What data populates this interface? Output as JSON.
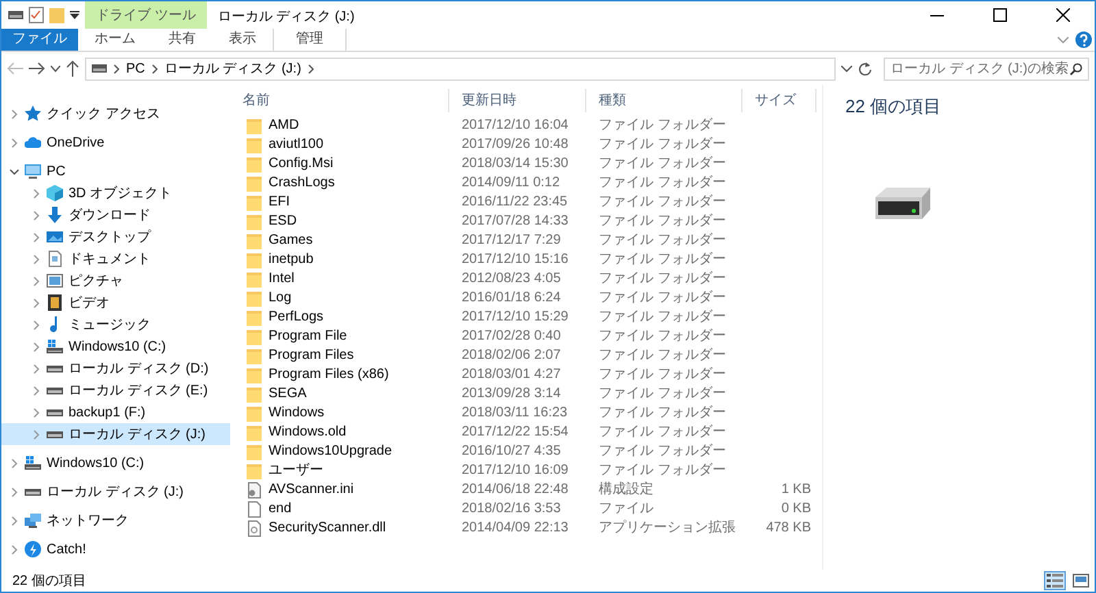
{
  "window": {
    "title": "ローカル ディスク (J:)",
    "context_tab_group": "ドライブ ツール"
  },
  "ribbon_tabs": [
    {
      "label": "ファイル",
      "kind": "file",
      "selected": false
    },
    {
      "label": "ホーム",
      "kind": "tab",
      "selected": false
    },
    {
      "label": "共有",
      "kind": "tab",
      "selected": false
    },
    {
      "label": "表示",
      "kind": "tab",
      "selected": false
    },
    {
      "label": "管理",
      "kind": "context",
      "selected": false
    }
  ],
  "address": {
    "breadcrumbs": [
      "PC",
      "ローカル ディスク (J:)"
    ],
    "search_placeholder": "ローカル ディスク (J:)の検索"
  },
  "navigation": [
    {
      "label": "クイック アクセス",
      "kind": "star",
      "expanded": false,
      "selected": false
    },
    {
      "label": "OneDrive",
      "kind": "cloud",
      "expanded": false,
      "selected": false
    },
    {
      "label": "PC",
      "kind": "pc",
      "expanded": true,
      "selected": false,
      "children": [
        {
          "label": "3D オブジェクト",
          "kind": "cube",
          "expanded": false,
          "selected": false
        },
        {
          "label": "ダウンロード",
          "kind": "download",
          "expanded": false,
          "selected": false
        },
        {
          "label": "デスクトップ",
          "kind": "desktop",
          "expanded": false,
          "selected": false
        },
        {
          "label": "ドキュメント",
          "kind": "document",
          "expanded": false,
          "selected": false
        },
        {
          "label": "ピクチャ",
          "kind": "picture",
          "expanded": false,
          "selected": false
        },
        {
          "label": "ビデオ",
          "kind": "video",
          "expanded": false,
          "selected": false
        },
        {
          "label": "ミュージック",
          "kind": "music",
          "expanded": false,
          "selected": false
        },
        {
          "label": "Windows10 (C:)",
          "kind": "windrive",
          "expanded": false,
          "selected": false
        },
        {
          "label": "ローカル ディスク (D:)",
          "kind": "drive",
          "expanded": false,
          "selected": false
        },
        {
          "label": "ローカル ディスク (E:)",
          "kind": "drive",
          "expanded": false,
          "selected": false
        },
        {
          "label": "backup1 (F:)",
          "kind": "drive",
          "expanded": false,
          "selected": false
        },
        {
          "label": "ローカル ディスク (J:)",
          "kind": "drive",
          "expanded": false,
          "selected": true
        }
      ]
    },
    {
      "label": "Windows10 (C:)",
      "kind": "windrive",
      "expanded": false,
      "selected": false
    },
    {
      "label": "ローカル ディスク (J:)",
      "kind": "drive",
      "expanded": false,
      "selected": false
    },
    {
      "label": "ネットワーク",
      "kind": "network",
      "expanded": false,
      "selected": false
    },
    {
      "label": "Catch!",
      "kind": "catch",
      "expanded": false,
      "selected": false
    }
  ],
  "columns": [
    "名前",
    "更新日時",
    "種類",
    "サイズ"
  ],
  "files": [
    {
      "name": "AMD",
      "modified": "2017/12/10 16:04",
      "type": "ファイル フォルダー",
      "kind": "folder"
    },
    {
      "name": "aviutl100",
      "modified": "2017/09/26 10:48",
      "type": "ファイル フォルダー",
      "kind": "folder"
    },
    {
      "name": "Config.Msi",
      "modified": "2018/03/14 15:30",
      "type": "ファイル フォルダー",
      "kind": "folder"
    },
    {
      "name": "CrashLogs",
      "modified": "2014/09/11 0:12",
      "type": "ファイル フォルダー",
      "kind": "folder"
    },
    {
      "name": "EFI",
      "modified": "2016/11/22 23:45",
      "type": "ファイル フォルダー",
      "kind": "folder"
    },
    {
      "name": "ESD",
      "modified": "2017/07/28 14:33",
      "type": "ファイル フォルダー",
      "kind": "folder"
    },
    {
      "name": "Games",
      "modified": "2017/12/17 7:29",
      "type": "ファイル フォルダー",
      "kind": "folder"
    },
    {
      "name": "inetpub",
      "modified": "2017/12/10 15:16",
      "type": "ファイル フォルダー",
      "kind": "folder"
    },
    {
      "name": "Intel",
      "modified": "2012/08/23 4:05",
      "type": "ファイル フォルダー",
      "kind": "folder"
    },
    {
      "name": "Log",
      "modified": "2016/01/18 6:24",
      "type": "ファイル フォルダー",
      "kind": "folder"
    },
    {
      "name": "PerfLogs",
      "modified": "2017/12/10 15:29",
      "type": "ファイル フォルダー",
      "kind": "folder"
    },
    {
      "name": "Program File",
      "modified": "2017/02/28 0:40",
      "type": "ファイル フォルダー",
      "kind": "folder"
    },
    {
      "name": "Program Files",
      "modified": "2018/02/06 2:07",
      "type": "ファイル フォルダー",
      "kind": "folder"
    },
    {
      "name": "Program Files (x86)",
      "modified": "2018/03/01 4:27",
      "type": "ファイル フォルダー",
      "kind": "folder"
    },
    {
      "name": "SEGA",
      "modified": "2013/09/28 3:14",
      "type": "ファイル フォルダー",
      "kind": "folder"
    },
    {
      "name": "Windows",
      "modified": "2018/03/11 16:23",
      "type": "ファイル フォルダー",
      "kind": "folder"
    },
    {
      "name": "Windows.old",
      "modified": "2017/12/22 15:54",
      "type": "ファイル フォルダー",
      "kind": "folder"
    },
    {
      "name": "Windows10Upgrade",
      "modified": "2016/10/27 4:35",
      "type": "ファイル フォルダー",
      "kind": "folder"
    },
    {
      "name": "ユーザー",
      "modified": "2017/12/10 16:09",
      "type": "ファイル フォルダー",
      "kind": "folder"
    },
    {
      "name": "AVScanner.ini",
      "modified": "2014/06/18 22:48",
      "type": "構成設定",
      "size": "1 KB",
      "kind": "settings"
    },
    {
      "name": "end",
      "modified": "2018/02/16 3:53",
      "type": "ファイル",
      "size": "0 KB",
      "kind": "file"
    },
    {
      "name": "SecurityScanner.dll",
      "modified": "2014/04/09 22:13",
      "type": "アプリケーション拡張",
      "size": "478 KB",
      "kind": "dll"
    }
  ],
  "details_pane": {
    "item_count": "22 個の項目"
  },
  "status_bar": {
    "item_count": "22 個の項目",
    "views": [
      {
        "kind": "details",
        "selected": true
      },
      {
        "kind": "tiles",
        "selected": false
      }
    ]
  }
}
